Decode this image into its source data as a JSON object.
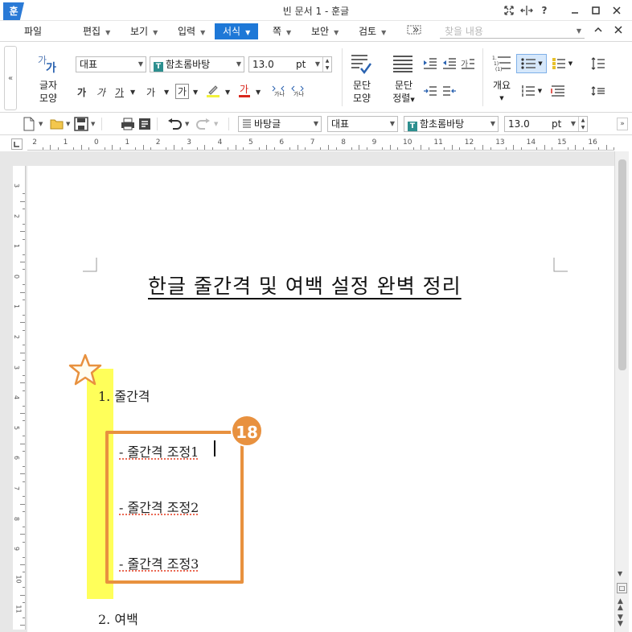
{
  "app": {
    "logo": "훈",
    "window_title": "빈 문서 1 - 훈글",
    "title_icons": [
      "expand-icon",
      "split-icon",
      "help-icon",
      "minimize-icon",
      "maximize-icon",
      "close-icon"
    ]
  },
  "menu": {
    "items": [
      {
        "label": "파일"
      },
      {
        "label": "편집"
      },
      {
        "label": "보기"
      },
      {
        "label": "입력"
      },
      {
        "label": "서식"
      },
      {
        "label": "쪽"
      },
      {
        "label": "보안"
      },
      {
        "label": "검토"
      }
    ],
    "active_index": 4,
    "search_placeholder": "찾을 내용"
  },
  "ribbon": {
    "char_shape_label_1": "글자",
    "char_shape_label_2": "모양",
    "style_combo": "대표",
    "font_combo": "함초롬바탕",
    "size_combo": "13.0",
    "size_unit": "pt",
    "para_shape_label_1": "문단",
    "para_shape_label_2": "모양",
    "para_align_label_1": "문단",
    "para_align_label_2": "정렬",
    "outline_label": "개요"
  },
  "toolbar2": {
    "para_style_combo": "바탕글",
    "style_combo": "대표",
    "font_combo": "함초롬바탕",
    "size_combo": "13.0",
    "size_unit": "pt"
  },
  "ruler": {
    "h_labels": [
      "2",
      "1",
      "0",
      "1",
      "2",
      "3",
      "4",
      "5",
      "6",
      "7",
      "8",
      "9",
      "10",
      "11",
      "12",
      "13",
      "14",
      "15",
      "16"
    ],
    "v_labels": [
      "3",
      "2",
      "1",
      "0",
      "1",
      "2",
      "3",
      "4",
      "5",
      "6",
      "7",
      "8",
      "9",
      "10",
      "11"
    ]
  },
  "document": {
    "title": "한글 줄간격 및 여백 설정 완벽 정리",
    "item1": "1. 줄간격",
    "sub1": "- 줄간격 조정1",
    "sub2": "- 줄간격 조정2",
    "sub3": "- 줄간격 조정3",
    "item2": "2. 여백"
  },
  "annotation": {
    "badge": "18",
    "highlight_color": "#ffff5a",
    "box_color": "#e8913f"
  },
  "colors": {
    "accent": "#1e78d7"
  }
}
